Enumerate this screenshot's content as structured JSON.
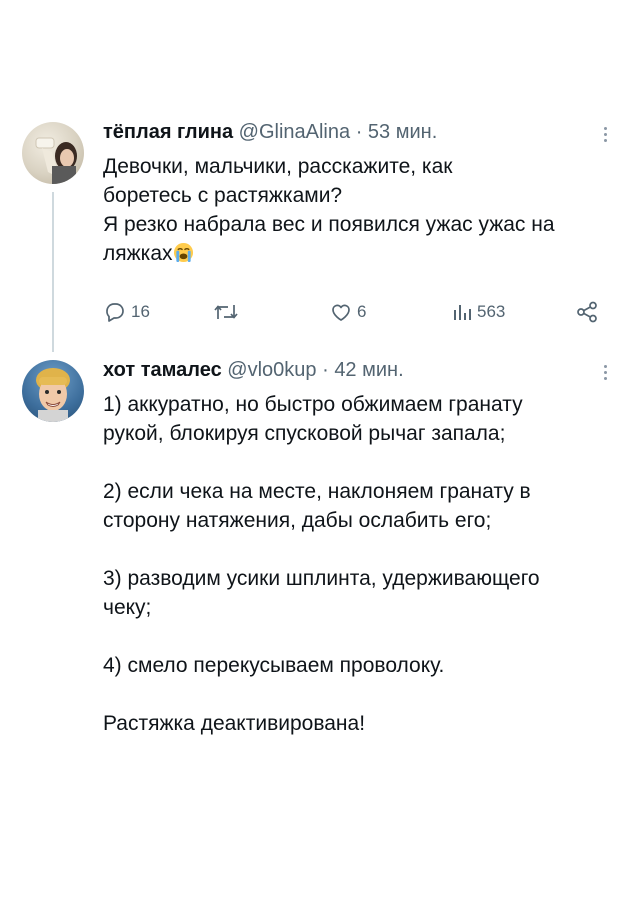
{
  "tweets": [
    {
      "name": "тёплая глина",
      "handle": "@GlinaAlina",
      "separator": "·",
      "time": "53 мин.",
      "lines": [
        "Девочки, мальчики, расскажите, как",
        "боретесь с растяжками?",
        "Я резко набрала вес и появился ужас ужас на",
        "ляжках"
      ],
      "emoji": "loudly-crying-face-emoji",
      "actions": {
        "replies": "16",
        "retweets": "",
        "likes": "6",
        "views": "563"
      }
    },
    {
      "name": "хот тамалес",
      "handle": "@vlo0kup",
      "separator": "·",
      "time": "42 мин.",
      "paragraphs": [
        [
          "1) аккуратно, но быстро обжимаем гранату",
          "рукой, блокируя спусковой рычаг запала;"
        ],
        [
          "2) если чека на месте, наклоняем гранату в",
          "сторону натяжения, дабы ослабить его;"
        ],
        [
          "3) разводим усики шплинта, удерживающего",
          "чеку;"
        ],
        [
          "4) смело перекусываем проволоку."
        ],
        [
          "Растяжка деактивирована!"
        ]
      ]
    }
  ],
  "icons": {
    "reply": "reply-icon",
    "retweet": "retweet-icon",
    "like": "heart-icon",
    "views": "views-chart-icon",
    "share": "share-icon",
    "more": "more-icon"
  },
  "colors": {
    "text": "#0f1419",
    "secondary": "#536471",
    "thread_line": "#cfd9de"
  }
}
